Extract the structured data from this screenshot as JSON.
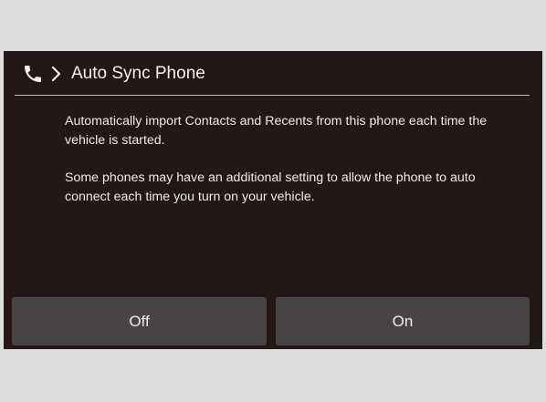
{
  "header": {
    "title": "Auto Sync Phone",
    "icons": [
      "phone-icon",
      "chevron-right-icon"
    ]
  },
  "body": {
    "paragraphs": [
      "Automatically import Contacts and Recents from this phone each time the vehicle is started.",
      "Some phones may have an additional setting to allow the phone to auto connect each time you turn on your vehicle."
    ]
  },
  "buttons": {
    "off_label": "Off",
    "on_label": "On"
  },
  "colors": {
    "page_background": "#dcdcdc",
    "screen_background": "#231815",
    "button_background": "#484444",
    "text": "#f2f2f2",
    "divider": "#bfbfbf"
  }
}
